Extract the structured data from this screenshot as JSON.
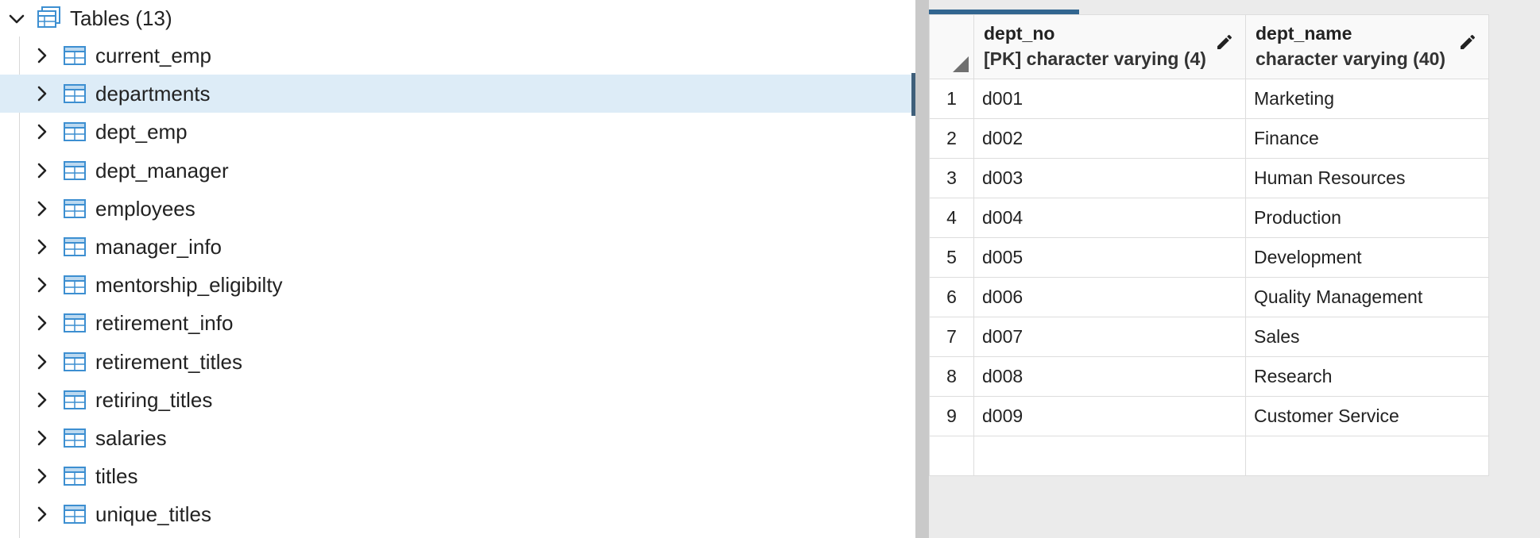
{
  "tree": {
    "header_label": "Tables (13)",
    "items": [
      {
        "label": "current_emp"
      },
      {
        "label": "departments",
        "selected": true
      },
      {
        "label": "dept_emp"
      },
      {
        "label": "dept_manager"
      },
      {
        "label": "employees"
      },
      {
        "label": "manager_info"
      },
      {
        "label": "mentorship_eligibilty"
      },
      {
        "label": "retirement_info"
      },
      {
        "label": "retirement_titles"
      },
      {
        "label": "retiring_titles"
      },
      {
        "label": "salaries"
      },
      {
        "label": "titles"
      },
      {
        "label": "unique_titles"
      }
    ]
  },
  "grid": {
    "columns": [
      {
        "name": "dept_no",
        "type": "[PK] character varying (4)"
      },
      {
        "name": "dept_name",
        "type": "character varying (40)"
      }
    ],
    "rows": [
      {
        "num": "1",
        "dept_no": "d001",
        "dept_name": "Marketing"
      },
      {
        "num": "2",
        "dept_no": "d002",
        "dept_name": "Finance"
      },
      {
        "num": "3",
        "dept_no": "d003",
        "dept_name": "Human Resources"
      },
      {
        "num": "4",
        "dept_no": "d004",
        "dept_name": "Production"
      },
      {
        "num": "5",
        "dept_no": "d005",
        "dept_name": "Development"
      },
      {
        "num": "6",
        "dept_no": "d006",
        "dept_name": "Quality Management"
      },
      {
        "num": "7",
        "dept_no": "d007",
        "dept_name": "Sales"
      },
      {
        "num": "8",
        "dept_no": "d008",
        "dept_name": "Research"
      },
      {
        "num": "9",
        "dept_no": "d009",
        "dept_name": "Customer Service"
      }
    ]
  },
  "icons": {
    "expand": "chevron-down-icon",
    "collapse": "chevron-right-icon",
    "table": "table-icon",
    "tables_group": "tables-group-icon",
    "edit": "pencil-icon"
  },
  "colors": {
    "selection": "#ddecf7",
    "accent": "#326690",
    "table_icon": "#3d8fd1",
    "splitter": "#c9c9c9"
  }
}
